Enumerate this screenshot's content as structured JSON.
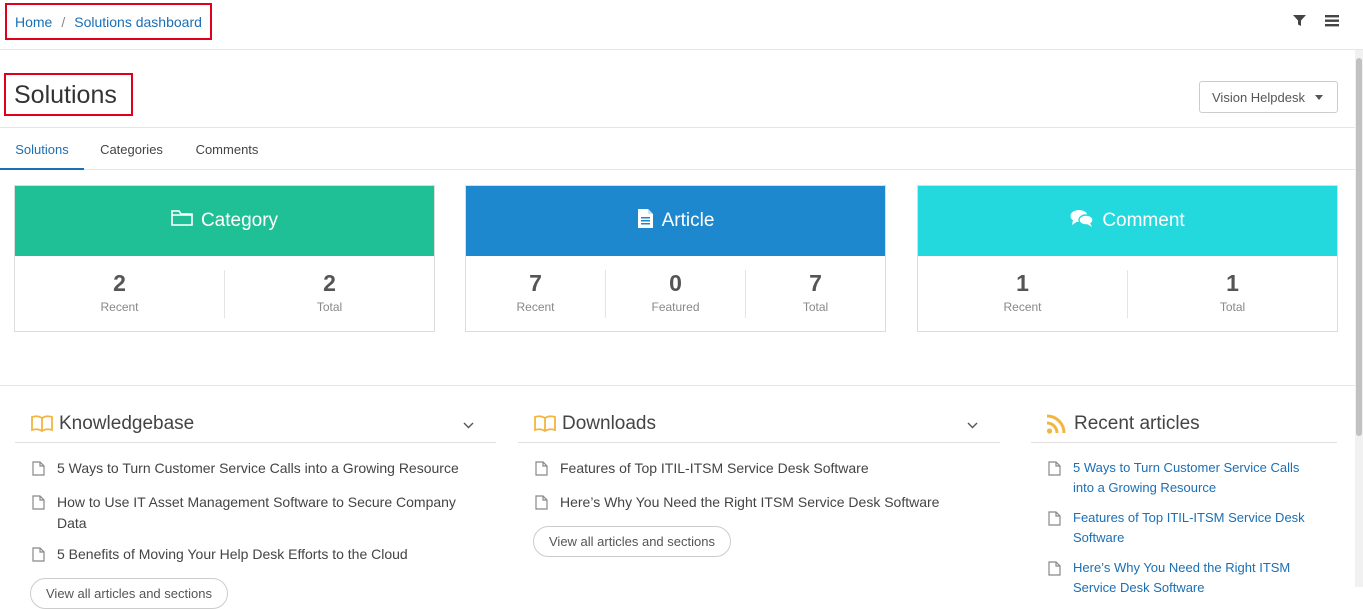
{
  "breadcrumb": {
    "home": "Home",
    "separator": "/",
    "current": "Solutions dashboard"
  },
  "toolbar": {
    "filter_icon": "filter-icon",
    "menu_icon": "menu-icon"
  },
  "page": {
    "title": "Solutions"
  },
  "helpdesk_selector": {
    "value": "Vision Helpdesk"
  },
  "tabs": [
    {
      "label": "Solutions",
      "active": true
    },
    {
      "label": "Categories",
      "active": false
    },
    {
      "label": "Comments",
      "active": false
    }
  ],
  "cards": {
    "category": {
      "title": "Category",
      "color": "#20c097",
      "icon": "folder-icon",
      "stats": [
        {
          "value": "2",
          "label": "Recent"
        },
        {
          "value": "2",
          "label": "Total"
        }
      ]
    },
    "article": {
      "title": "Article",
      "color": "#1e88ce",
      "icon": "document-icon",
      "stats": [
        {
          "value": "7",
          "label": "Recent"
        },
        {
          "value": "0",
          "label": "Featured"
        },
        {
          "value": "7",
          "label": "Total"
        }
      ]
    },
    "comment": {
      "title": "Comment",
      "color": "#24d9de",
      "icon": "comments-icon",
      "stats": [
        {
          "value": "1",
          "label": "Recent"
        },
        {
          "value": "1",
          "label": "Total"
        }
      ]
    }
  },
  "knowledgebase": {
    "title": "Knowledgebase",
    "items": [
      "5 Ways to Turn Customer Service Calls into a Growing Resource",
      "How to Use IT Asset Management Software to Secure Company Data",
      "5 Benefits of Moving Your Help Desk Efforts to the Cloud"
    ],
    "view_all": "View all articles and sections"
  },
  "downloads": {
    "title": "Downloads",
    "items": [
      "Features of Top ITIL-ITSM Service Desk Software",
      "Here’s Why You Need the Right ITSM Service Desk Software"
    ],
    "view_all": "View all articles and sections"
  },
  "recent_articles": {
    "title": "Recent articles",
    "items": [
      "5 Ways to Turn Customer Service Calls into a Growing Resource",
      "Features of Top ITIL-ITSM Service Desk Software",
      "Here’s Why You Need the Right ITSM Service Desk Software"
    ]
  },
  "colors": {
    "link": "#1a6fb5",
    "highlight_border": "#e0001b",
    "book_icon": "#f3b53f",
    "rss_icon": "#f3b53f"
  }
}
